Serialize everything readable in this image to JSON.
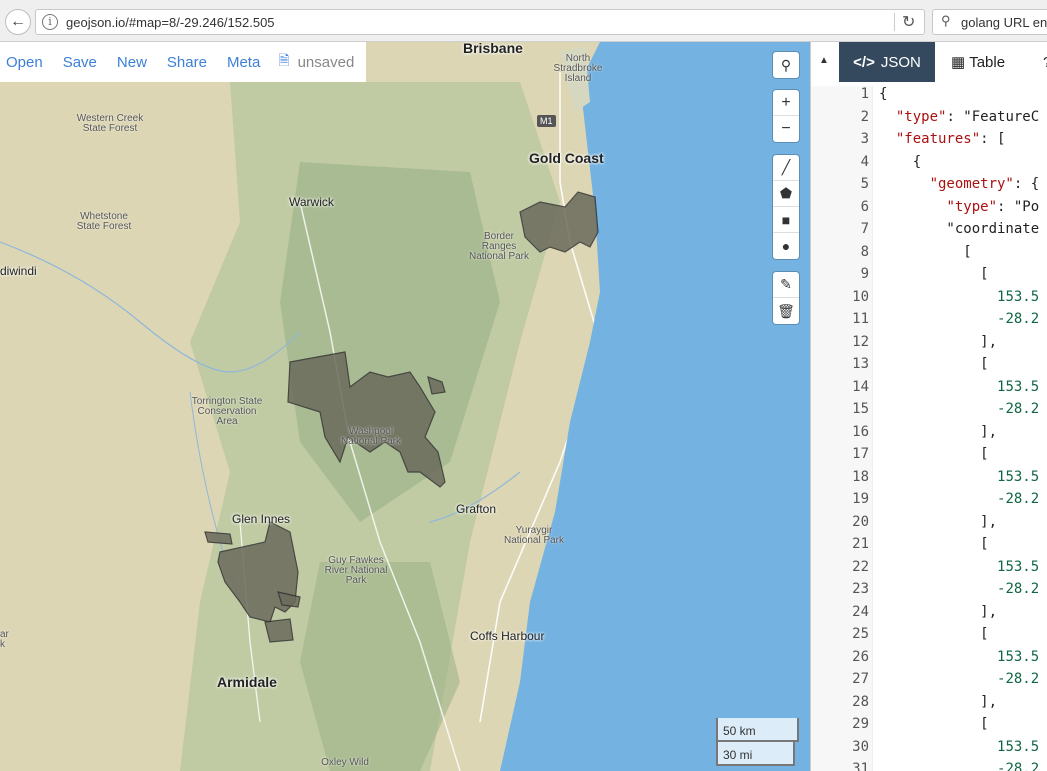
{
  "browser": {
    "url": "geojson.io/#map=8/-29.246/152.505",
    "search": "golang URL enc",
    "back_icon": "back-arrow-icon",
    "reload_icon": "reload-icon"
  },
  "menu": {
    "open": "Open",
    "save": "Save",
    "new": "New",
    "share": "Share",
    "meta": "Meta",
    "status": "unsaved"
  },
  "map": {
    "cities": {
      "brisbane": "Brisbane",
      "gold_coast": "Gold Coast",
      "warwick": "Warwick",
      "grafton": "Grafton",
      "glen_innes": "Glen Innes",
      "coffs_harbour": "Coffs Harbour",
      "armidale": "Armidale",
      "goondiwindi": "diwindi"
    },
    "parks": {
      "western_creek": "Western Creek State Forest",
      "whetstone": "Whetstone State Forest",
      "torrington": "Torrington State Conservation Area",
      "washpool": "Washpool National Park",
      "border_ranges": "Border Ranges National Park",
      "north_stradbroke": "North Stradbroke Island",
      "yuraygir": "Yuraygir National Park",
      "guy_fawkes": "Guy Fawkes River National Park",
      "oxley_wild": "Oxley Wild",
      "m1": "M1",
      "edge_label": "ar k"
    },
    "scale": {
      "km": "50 km",
      "mi": "30 mi"
    },
    "colors": {
      "land": "#d9d4b3",
      "ocean": "#73b2e1",
      "polygon": "#6b6b5c",
      "forest": "#b5c8a0"
    }
  },
  "panel": {
    "tabs": {
      "json": "JSON",
      "table": "Table"
    },
    "lines": [
      {
        "n": "1",
        "t": "{"
      },
      {
        "n": "2",
        "t": "  \"type\": \"FeatureC"
      },
      {
        "n": "3",
        "t": "  \"features\": ["
      },
      {
        "n": "4",
        "t": "    {"
      },
      {
        "n": "5",
        "t": "      \"geometry\": {"
      },
      {
        "n": "6",
        "t": "        \"type\": \"Po"
      },
      {
        "n": "7",
        "t": "        \"coordinate"
      },
      {
        "n": "8",
        "t": "          ["
      },
      {
        "n": "9",
        "t": "            ["
      },
      {
        "n": "10",
        "t": "              153.5"
      },
      {
        "n": "11",
        "t": "              -28.2"
      },
      {
        "n": "12",
        "t": "            ],"
      },
      {
        "n": "13",
        "t": "            ["
      },
      {
        "n": "14",
        "t": "              153.5"
      },
      {
        "n": "15",
        "t": "              -28.2"
      },
      {
        "n": "16",
        "t": "            ],"
      },
      {
        "n": "17",
        "t": "            ["
      },
      {
        "n": "18",
        "t": "              153.5"
      },
      {
        "n": "19",
        "t": "              -28.2"
      },
      {
        "n": "20",
        "t": "            ],"
      },
      {
        "n": "21",
        "t": "            ["
      },
      {
        "n": "22",
        "t": "              153.5"
      },
      {
        "n": "23",
        "t": "              -28.2"
      },
      {
        "n": "24",
        "t": "            ],"
      },
      {
        "n": "25",
        "t": "            ["
      },
      {
        "n": "26",
        "t": "              153.5"
      },
      {
        "n": "27",
        "t": "              -28.2"
      },
      {
        "n": "28",
        "t": "            ],"
      },
      {
        "n": "29",
        "t": "            ["
      },
      {
        "n": "30",
        "t": "              153.5"
      },
      {
        "n": "31",
        "t": "              -28.2"
      }
    ]
  }
}
